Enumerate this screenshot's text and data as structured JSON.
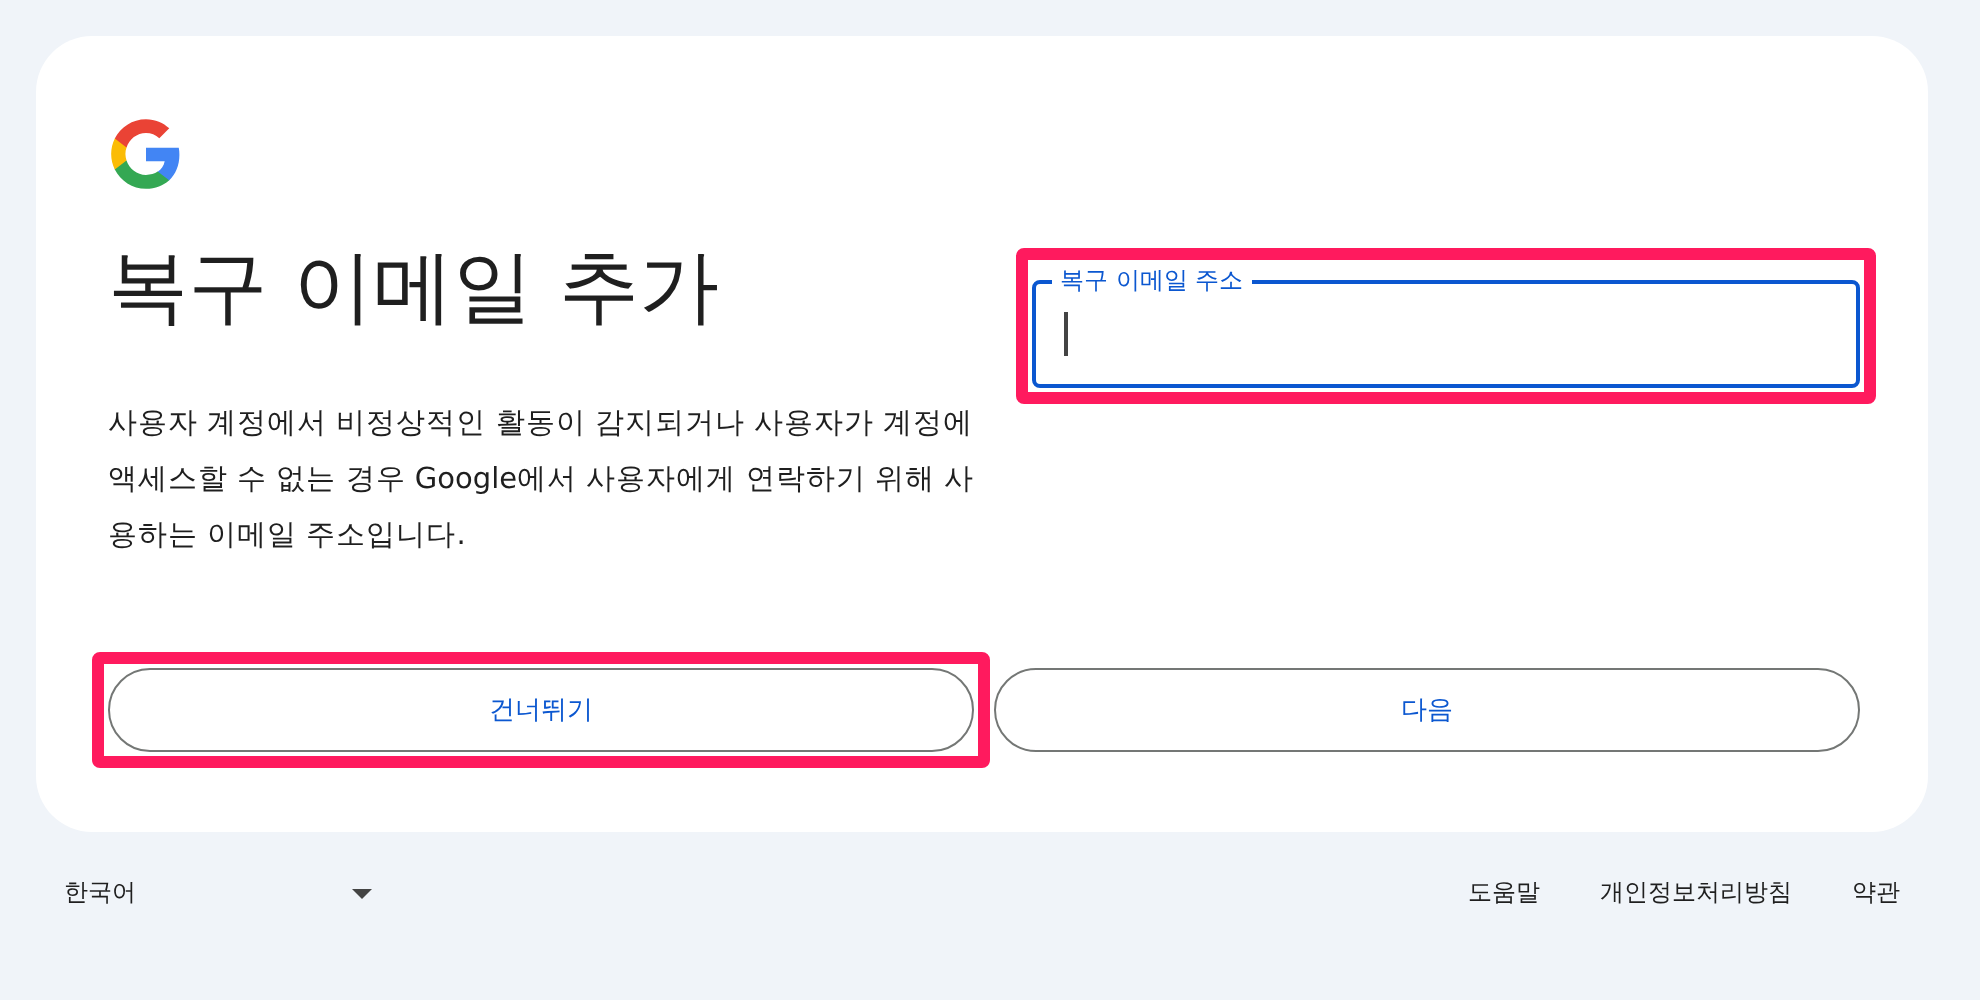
{
  "title": "복구 이메일 추가",
  "description": "사용자 계정에서 비정상적인 활동이 감지되거나 사용자가 계정에 액세스할 수 없는 경우 Google에서 사용자에게 연락하기 위해 사용하는 이메일 주소입니다.",
  "field": {
    "label": "복구 이메일 주소",
    "focused": true,
    "highlighted": true
  },
  "buttons": [
    {
      "label": "건너뛰기",
      "highlighted": true
    },
    {
      "label": "다음",
      "highlighted": false
    }
  ],
  "footer": {
    "language": "한국어",
    "links": [
      "도움말",
      "개인정보처리방침",
      "약관"
    ]
  }
}
